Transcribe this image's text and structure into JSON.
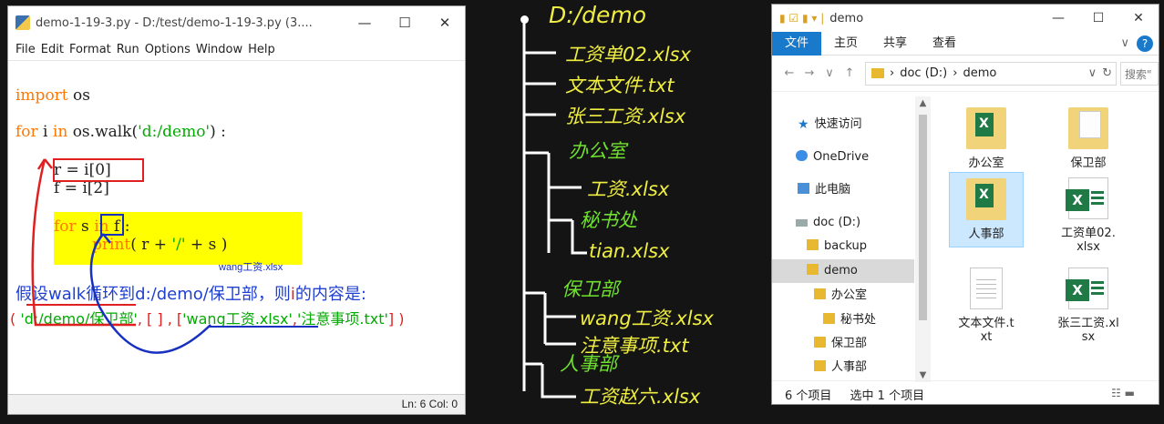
{
  "idle": {
    "title": "demo-1-19-3.py - D:/test/demo-1-19-3.py (3....",
    "menu": [
      "File",
      "Edit",
      "Format",
      "Run",
      "Options",
      "Window",
      "Help"
    ],
    "code": {
      "import_kw": "import",
      "import_rest": " os",
      "for_kw": "for",
      "for_var": "  i  ",
      "in_kw": "in",
      "walk_call": "  os.walk(",
      "walk_arg": "'d:/demo'",
      "walk_end": ") :",
      "line_r": "r = i[0]",
      "line_f": "f = i[2]",
      "for2_kw": "for",
      "for2_var": "  s  ",
      "in2_kw": "in",
      "for2_rest": "  f :",
      "print_kw": "print",
      "print_open": "( r + ",
      "print_sep": "'/'",
      "print_end": " + s )"
    },
    "annotation_wang": "wang工资.xlsx",
    "explain_prefix": "假设walk循环到d:/demo/保卫部，则",
    "explain_i": "i",
    "explain_suffix": "的内容是:",
    "list_open": "(",
    "list_item1": "'d:/demo/保卫部'",
    "list_mid1": ", [ ] , [",
    "list_item2": "'wang工资.xlsx'",
    "list_comma": ",",
    "list_item3": "'注意事项.txt'",
    "list_close": "] )",
    "status": "Ln: 6  Col: 0"
  },
  "tree": {
    "root": "D:/demo",
    "items": [
      {
        "label": "工资单02.xlsx",
        "kind": "file"
      },
      {
        "label": "文本文件.txt",
        "kind": "file"
      },
      {
        "label": "张三工资.xlsx",
        "kind": "file"
      },
      {
        "label": "办公室",
        "kind": "folder"
      },
      {
        "label": "工资.xlsx",
        "kind": "file"
      },
      {
        "label": "秘书处",
        "kind": "folder"
      },
      {
        "label": "tian.xlsx",
        "kind": "file"
      },
      {
        "label": "保卫部",
        "kind": "folder"
      },
      {
        "label": "wang工资.xlsx",
        "kind": "file"
      },
      {
        "label": "注意事项.txt",
        "kind": "file"
      },
      {
        "label": "人事部",
        "kind": "folder"
      },
      {
        "label": "工资赵六.xlsx",
        "kind": "file"
      }
    ]
  },
  "explorer": {
    "title": "demo",
    "ribbon_tabs": [
      "文件",
      "主页",
      "共享",
      "查看"
    ],
    "breadcrumb": [
      "doc (D:)",
      "demo"
    ],
    "search_placeholder": "搜索\"",
    "nav": [
      {
        "label": "快速访问",
        "icon": "star-icon"
      },
      {
        "label": "OneDrive",
        "icon": "cloud-icon"
      },
      {
        "label": "此电脑",
        "icon": "pc-icon"
      },
      {
        "label": "doc (D:)",
        "icon": "drive-icon"
      },
      {
        "label": "backup",
        "icon": "folder-icon"
      },
      {
        "label": "demo",
        "icon": "folder-icon"
      },
      {
        "label": "办公室",
        "icon": "folder-icon"
      },
      {
        "label": "秘书处",
        "icon": "folder-icon"
      },
      {
        "label": "保卫部",
        "icon": "folder-icon"
      },
      {
        "label": "人事部",
        "icon": "folder-icon"
      }
    ],
    "files": [
      {
        "label": "办公室",
        "type": "folder-excel"
      },
      {
        "label": "保卫部",
        "type": "folder-paper"
      },
      {
        "label": "人事部",
        "type": "folder-excel"
      },
      {
        "label": "工资单02.xlsx",
        "type": "xlsx"
      },
      {
        "label": "文本文件.txt",
        "type": "txt"
      },
      {
        "label": "张三工资.xlsx",
        "type": "xlsx"
      }
    ],
    "status_count": "6 个项目",
    "status_selected": "选中 1 个项目"
  }
}
